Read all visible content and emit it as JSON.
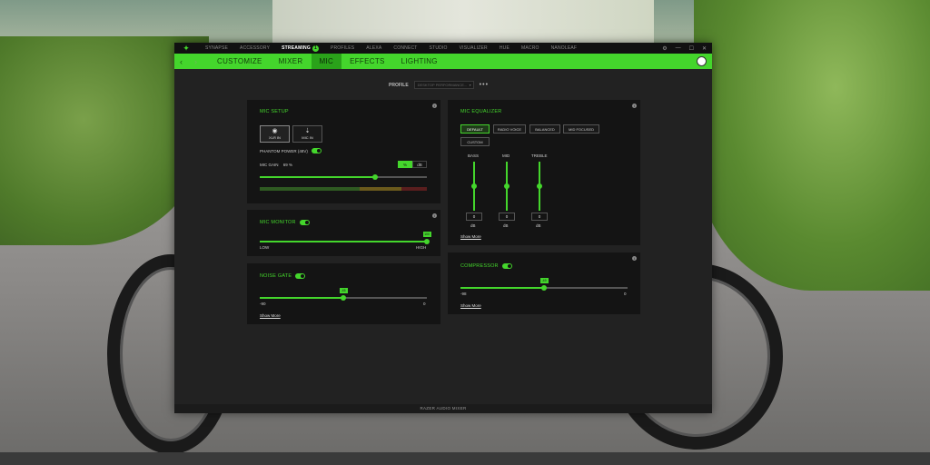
{
  "app": {
    "top_tabs": [
      "SYNAPSE",
      "ACCESSORY",
      "STREAMING",
      "PROFILES",
      "ALEXA",
      "CONNECT",
      "STUDIO",
      "VISUALIZER",
      "HUE",
      "MACRO",
      "NANOLEAF"
    ],
    "active_top_tab": "STREAMING",
    "streaming_badge": "1",
    "sub_tabs": [
      "CUSTOMIZE",
      "MIXER",
      "MIC",
      "EFFECTS",
      "LIGHTING"
    ],
    "active_sub_tab": "MIC",
    "footer_title": "RAZER AUDIO MIXER",
    "accent_color": "#44d62c"
  },
  "profile": {
    "label": "PROFILE",
    "selected": "DESKTOP PERFORMANCE...",
    "more": "•••"
  },
  "mic_setup": {
    "title": "MIC SETUP",
    "sources": [
      {
        "label": "XLR IN",
        "icon": "xlr-icon"
      },
      {
        "label": "MIC IN",
        "icon": "mic-jack-icon"
      }
    ],
    "phantom_label": "PHANTOM POWER (48V)",
    "gain_label": "MIC GAIN",
    "gain_value": "69 %",
    "gain_fraction": 0.69,
    "unit_percent": "%",
    "unit_db": "dB"
  },
  "mic_monitor": {
    "title": "MIC MONITOR",
    "low": "LOW",
    "high": "HIGH",
    "tip": "100",
    "fraction": 1.0
  },
  "noise_gate": {
    "title": "NOISE GATE",
    "min": "-90",
    "max": "0",
    "tip": "-45",
    "fraction": 0.5,
    "show_more": "Show More"
  },
  "mic_equalizer": {
    "title": "MIC EQUALIZER",
    "presets": [
      "DEFAULT",
      "RADIO VOICE",
      "BALANCED",
      "MID FOCUSED",
      "CUSTOM"
    ],
    "active_preset": "DEFAULT",
    "bands": [
      {
        "name": "BASS",
        "value": "0",
        "unit": "dB"
      },
      {
        "name": "MID",
        "value": "0",
        "unit": "dB"
      },
      {
        "name": "TREBLE",
        "value": "0",
        "unit": "dB"
      }
    ],
    "show_more": "Show More"
  },
  "compressor": {
    "title": "COMPRESSOR",
    "min": "-98",
    "max": "0",
    "tip": "-49",
    "fraction": 0.5,
    "show_more": "Show More"
  }
}
